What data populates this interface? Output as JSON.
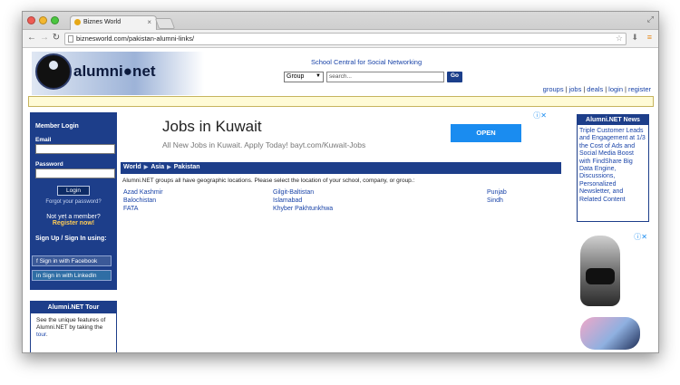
{
  "browser": {
    "tab_title": "Biznes World",
    "tab_close": "×",
    "url": "biznesworld.com/pakistan-alumni-links/",
    "colors": {
      "close": "#ee5b53",
      "minimize": "#f3b72f",
      "maximize": "#4bc640"
    }
  },
  "header": {
    "logo_text": "alumni●net",
    "tagline": "School Central for Social Networking",
    "search": {
      "select_value": "Group",
      "placeholder": "search...",
      "go_label": "Go"
    },
    "top_links": [
      "groups",
      "jobs",
      "deals",
      "login",
      "register"
    ]
  },
  "login": {
    "title": "Member Login",
    "email_label": "Email",
    "password_label": "Password",
    "login_button": "Login",
    "forgot": "Forgot your password?",
    "not_member": "Not yet a member?",
    "register": "Register now!",
    "signup_title": "Sign Up / Sign In using:",
    "facebook": "Sign in with Facebook",
    "linkedin": "Sign in with LinkedIn"
  },
  "tour": {
    "title": "Alumni.NET Tour",
    "body": "See the unique features of Alumni.NET by taking the",
    "link": "tour",
    "end": "."
  },
  "ad": {
    "title": "Jobs in Kuwait",
    "subtitle": "All New Jobs in Kuwait. Apply Today! bayt.com/Kuwait-Jobs",
    "button": "OPEN"
  },
  "breadcrumb": [
    "World",
    "Asia",
    "Pakistan"
  ],
  "intro": "Alumni.NET groups all have geographic locations. Please select the location of your school, company, or group.:",
  "locations": {
    "col1": [
      "Azad Kashmir",
      "Balochistan",
      "FATA"
    ],
    "col2": [
      "Gilgit-Baltistan",
      "Islamabad",
      "Khyber Pakhtunkhwa"
    ],
    "col3": [
      "Punjab",
      "Sindh"
    ]
  },
  "news": {
    "title": "Alumni.NET News",
    "body": "Triple Customer Leads and Engagement at 1/3 the Cost of Ads and Social Media Boost with FindShare Big Data Engine, Discussions, Personalized Newsletter, and Related Content"
  }
}
